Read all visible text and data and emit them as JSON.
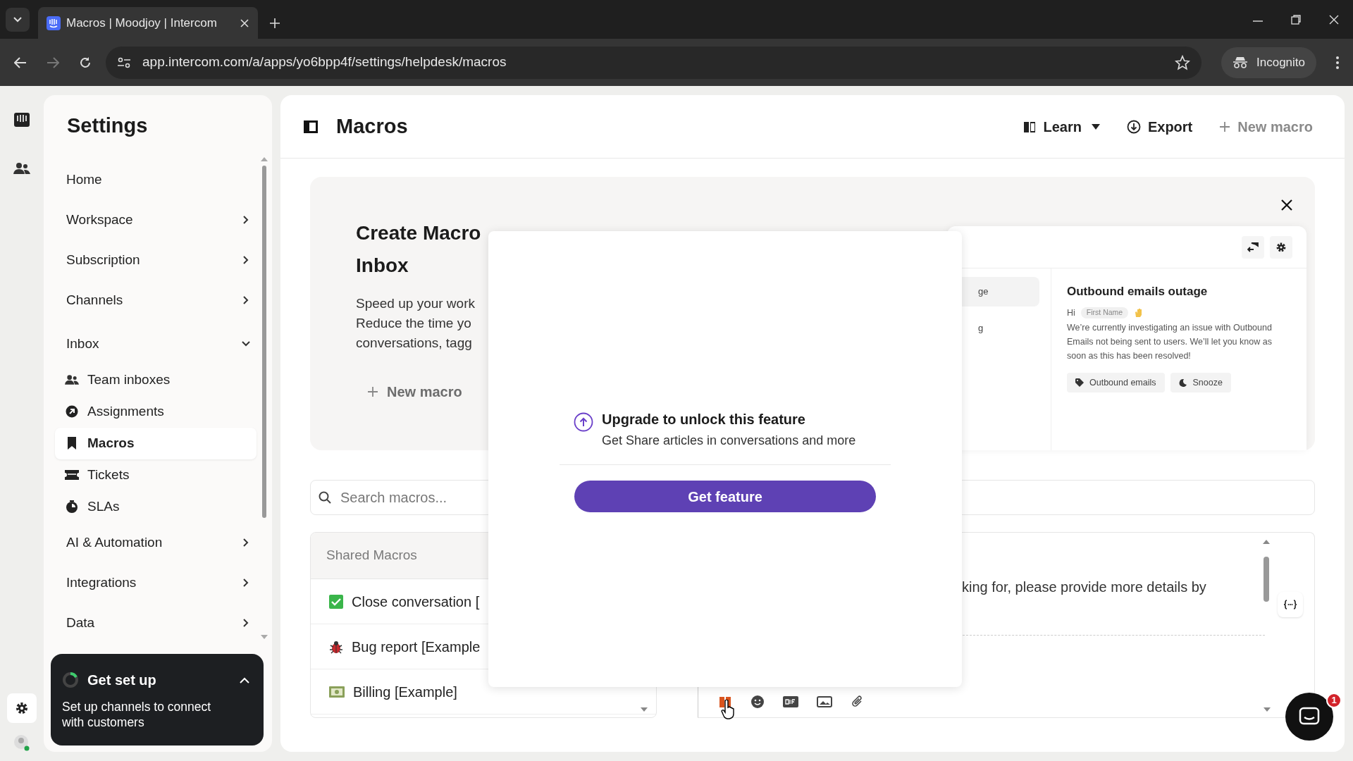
{
  "browser": {
    "tab_title": "Macros | Moodjoy | Intercom",
    "url": "app.intercom.com/a/apps/yo6bpp4f/settings/helpdesk/macros",
    "profile": "Incognito"
  },
  "settings": {
    "title": "Settings",
    "items": [
      {
        "label": "Home",
        "kind": "link",
        "selected": false
      },
      {
        "label": "Workspace",
        "kind": "group",
        "expanded": false,
        "selected": false
      },
      {
        "label": "Subscription",
        "kind": "group",
        "expanded": false,
        "selected": false
      },
      {
        "label": "Channels",
        "kind": "group",
        "expanded": false,
        "selected": false
      },
      {
        "label": "Inbox",
        "kind": "group",
        "expanded": true,
        "selected": false
      },
      {
        "label": "Team inboxes",
        "kind": "sub",
        "selected": false
      },
      {
        "label": "Assignments",
        "kind": "sub",
        "selected": false
      },
      {
        "label": "Macros",
        "kind": "sub",
        "selected": true
      },
      {
        "label": "Tickets",
        "kind": "sub",
        "selected": false
      },
      {
        "label": "SLAs",
        "kind": "sub",
        "selected": false
      },
      {
        "label": "AI & Automation",
        "kind": "group",
        "expanded": false,
        "selected": false
      },
      {
        "label": "Integrations",
        "kind": "group",
        "expanded": false,
        "selected": false
      },
      {
        "label": "Data",
        "kind": "group",
        "expanded": false,
        "selected": false
      }
    ]
  },
  "setup_card": {
    "title": "Get set up",
    "text": "Set up channels to connect with customers",
    "expanded": true
  },
  "header": {
    "title": "Macros",
    "buttons": [
      {
        "label": "Learn",
        "kind": "learn"
      },
      {
        "label": "Export",
        "kind": "export"
      },
      {
        "label": "New macro",
        "kind": "new"
      }
    ]
  },
  "banner": {
    "title_lines": [
      "Create Macro",
      "Inbox"
    ],
    "text_lines": [
      "Speed up your work",
      "Reduce the time yo",
      "conversations, tagg"
    ],
    "button": "New macro",
    "preview": {
      "rows": [
        {
          "label": "ge",
          "selected": true
        },
        {
          "label": "g",
          "selected": false
        }
      ],
      "title": "Outbound emails outage",
      "greeting": "Hi",
      "variable": "First Name",
      "body": "We’re currently investigating an issue with Outbound Emails not being sent to users. We’ll let you know as soon as this has been resolved!",
      "tags": [
        {
          "label": "Outbound emails",
          "kind": "tag"
        },
        {
          "label": "Snooze",
          "kind": "snooze"
        }
      ]
    }
  },
  "popup": {
    "title": "Upgrade to unlock this feature",
    "subtitle": "Get Share articles in conversations and more",
    "button": "Get feature"
  },
  "search": {
    "placeholder": "Search macros..."
  },
  "macros": {
    "header": "Shared Macros",
    "items": [
      {
        "label": "Close conversation [",
        "selected": false
      },
      {
        "label": "Bug report [Example",
        "selected": false
      },
      {
        "label": "Billing [Example]",
        "selected": false
      }
    ]
  },
  "editor": {
    "text": "king for, please provide more details by"
  },
  "launcher": {
    "badge": "1"
  }
}
